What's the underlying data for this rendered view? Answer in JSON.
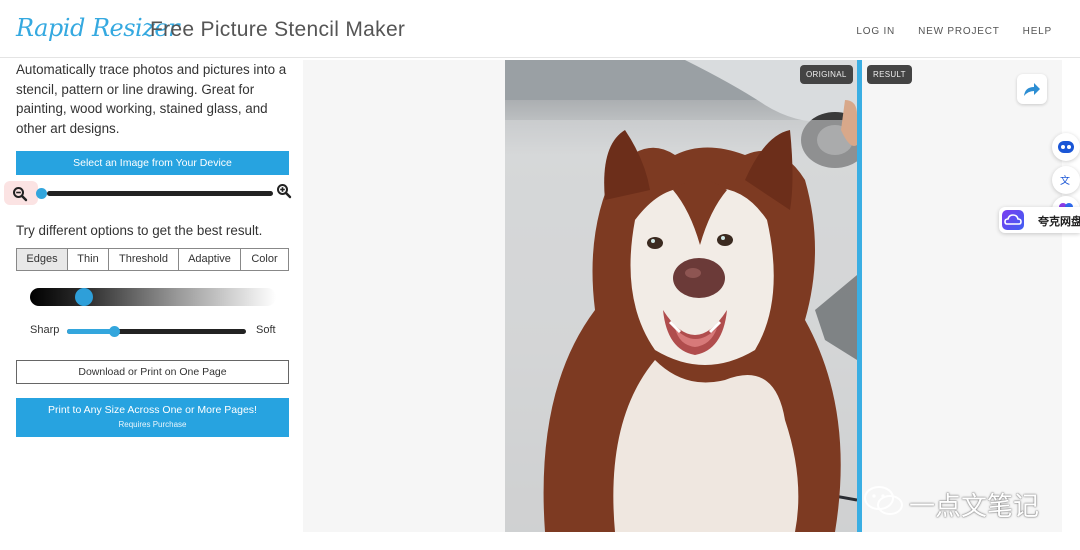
{
  "header": {
    "logo_text": "Rapid Resizer",
    "app_title": "Free Picture Stencil Maker",
    "nav": [
      {
        "label": "LOG IN"
      },
      {
        "label": "NEW PROJECT"
      },
      {
        "label": "HELP"
      }
    ]
  },
  "sidebar": {
    "intro": "Automatically trace photos and pictures into a stencil, pattern or line drawing. Great for painting, wood working, stained glass, and other art designs.",
    "select_button": "Select an Image from Your Device",
    "zoom": {
      "zoom_out_icon": "zoom-out-icon",
      "zoom_in_icon": "zoom-in-icon",
      "level_fraction": 0.0
    },
    "options_text": "Try different options to get the best result.",
    "tabs": [
      {
        "label": "Edges",
        "active": true
      },
      {
        "label": "Thin",
        "active": false
      },
      {
        "label": "Threshold",
        "active": false
      },
      {
        "label": "Adaptive",
        "active": false
      },
      {
        "label": "Color",
        "active": false
      }
    ],
    "gradient_slider": {
      "level_fraction": 0.22
    },
    "sharpness": {
      "left_label": "Sharp",
      "right_label": "Soft",
      "level_fraction": 0.26
    },
    "download_button": "Download or Print on One Page",
    "print_button": {
      "main": "Print to Any Size Across One or More Pages!",
      "sub": "Requires Purchase"
    }
  },
  "workspace": {
    "badge_original": "ORIGINAL",
    "badge_result": "RESULT",
    "share_icon": "share-arrow-icon"
  },
  "overlay": {
    "cloud_label": "夸克网盘",
    "watermark": "一点文笔记"
  },
  "colors": {
    "accent": "#27a3e0",
    "divider": "#3aaee3",
    "badge_bg": "#444444"
  }
}
